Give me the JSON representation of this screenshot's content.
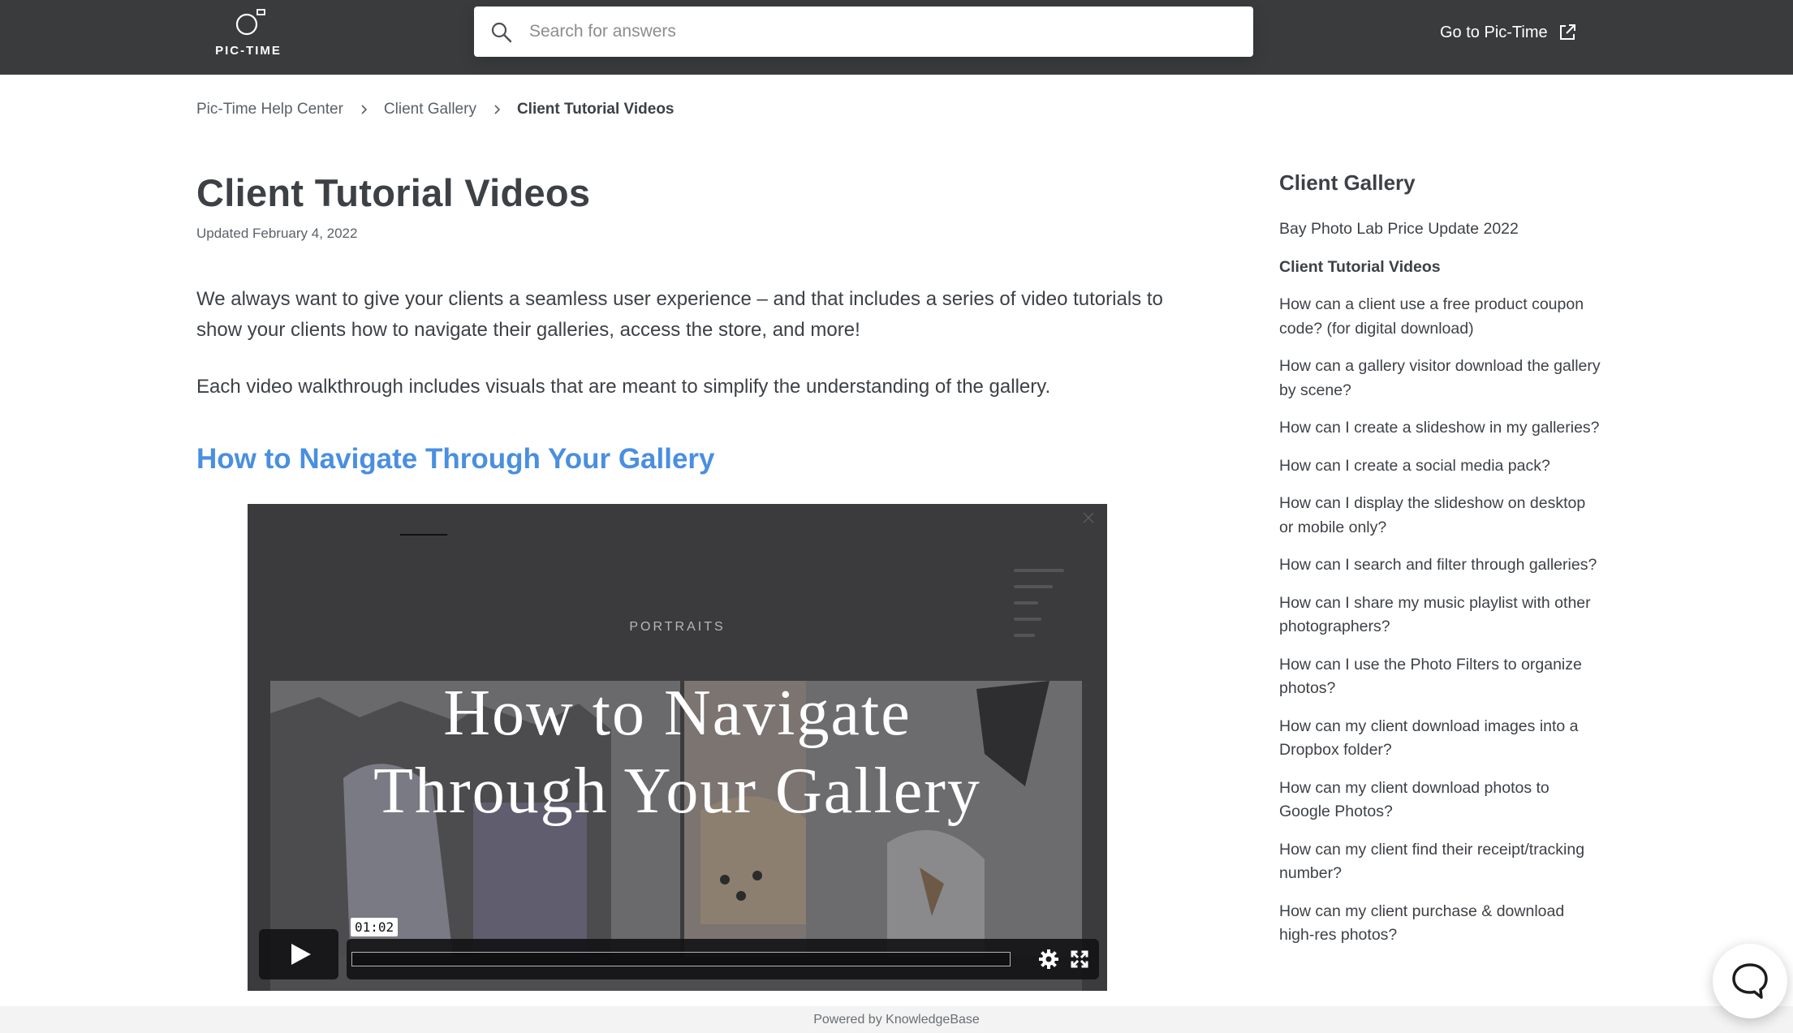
{
  "header": {
    "logo_text": "PIC-TIME",
    "search_placeholder": "Search for answers",
    "goto_label": "Go to Pic-Time"
  },
  "breadcrumb": [
    "Pic-Time Help Center",
    "Client Gallery",
    "Client Tutorial Videos"
  ],
  "article": {
    "title": "Client Tutorial Videos",
    "updated": "Updated February 4, 2022",
    "paragraphs": [
      "We always want to give your clients a seamless user experience – and that includes a series of video tutorials to show your clients how to navigate their galleries, access the store, and more!",
      "Each video walkthrough includes visuals that are meant to simplify the understanding of the gallery."
    ],
    "section_heading": "How to Navigate Through Your Gallery"
  },
  "video": {
    "category": "PORTRAITS",
    "title_line1": "How to Navigate",
    "title_line2": "Through Your Gallery",
    "timecode": "01:02",
    "progress": 0.0
  },
  "sidebar": {
    "title": "Client Gallery",
    "items": [
      {
        "label": "Bay Photo Lab Price Update 2022",
        "active": false
      },
      {
        "label": "Client Tutorial Videos",
        "active": true
      },
      {
        "label": "How can a client use a free product coupon code? (for digital download)",
        "active": false
      },
      {
        "label": "How can a gallery visitor download the gallery by scene?",
        "active": false
      },
      {
        "label": "How can I create a slideshow in my galleries?",
        "active": false
      },
      {
        "label": "How can I create a social media pack?",
        "active": false
      },
      {
        "label": "How can I display the slideshow on desktop or mobile only?",
        "active": false
      },
      {
        "label": "How can I search and filter through galleries?",
        "active": false
      },
      {
        "label": "How can I share my music playlist with other photographers?",
        "active": false
      },
      {
        "label": "How can I use the Photo Filters to organize photos?",
        "active": false
      },
      {
        "label": "How can my client download images into a Dropbox folder?",
        "active": false
      },
      {
        "label": "How can my client download photos to Google Photos?",
        "active": false
      },
      {
        "label": "How can my client find their receipt/tracking number?",
        "active": false
      },
      {
        "label": "How can my client purchase & download high-res photos?",
        "active": false
      }
    ]
  },
  "footer": {
    "text": "Powered by KnowledgeBase"
  },
  "colors": {
    "header_bg": "#3a3b3c",
    "link_blue": "#4a8fe0",
    "text": "#3d4146"
  },
  "icons": [
    "pic-time-logo-icon",
    "search-icon",
    "external-link-icon",
    "chevron-right-icon",
    "play-icon",
    "gear-icon",
    "fullscreen-icon",
    "chat-icon"
  ]
}
